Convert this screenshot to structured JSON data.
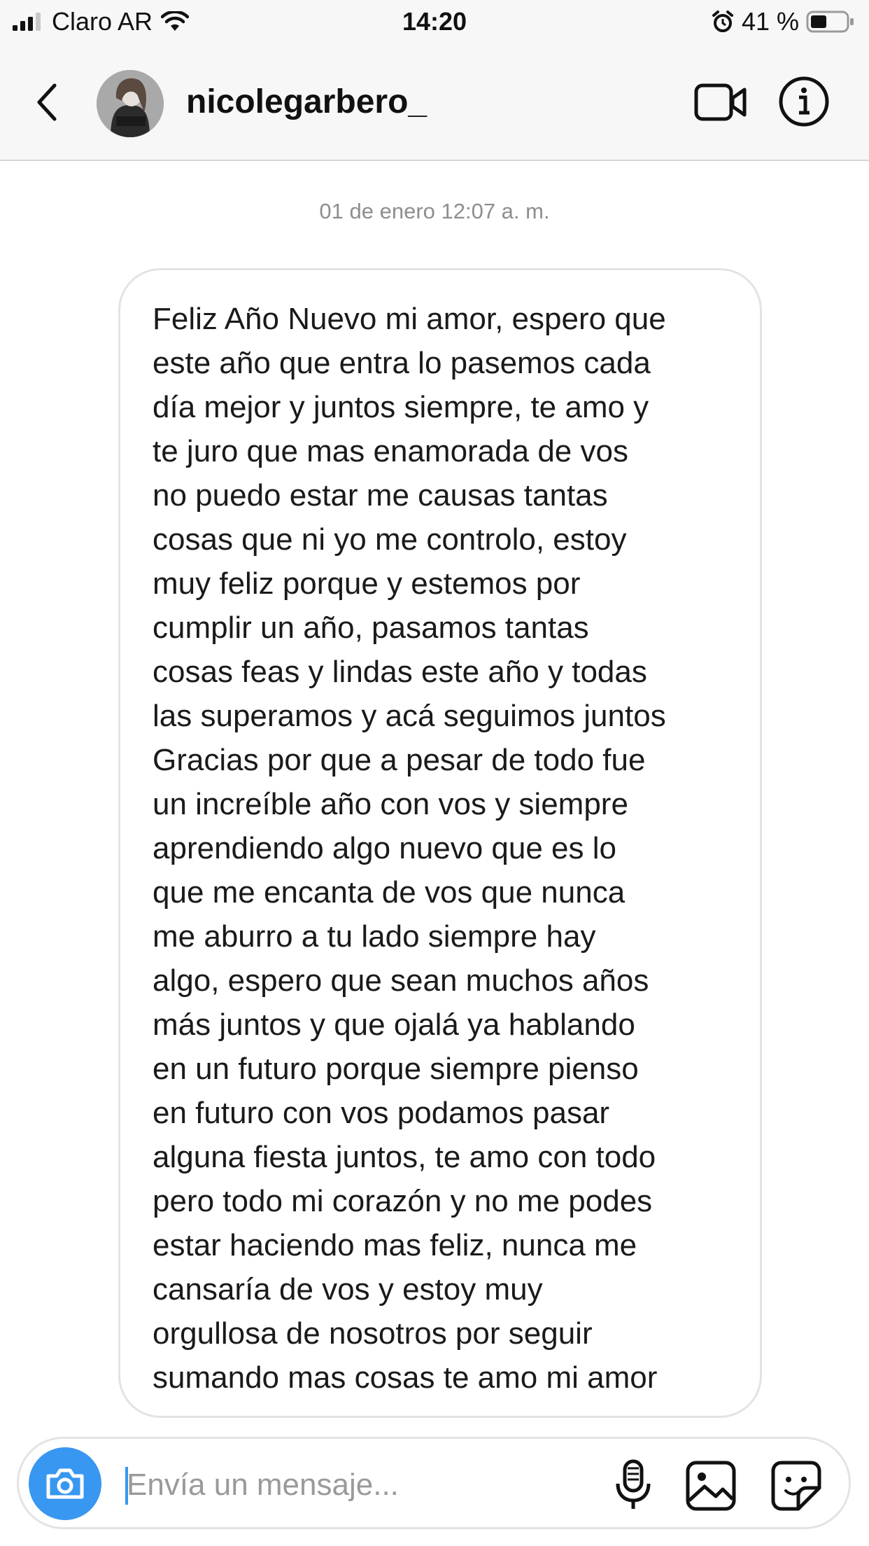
{
  "status_bar": {
    "carrier": "Claro AR",
    "time": "14:20",
    "battery": "41 %",
    "icons": [
      "signal-icon",
      "wifi-icon",
      "alarm-icon",
      "battery-icon"
    ]
  },
  "header": {
    "username": "nicolegarbero_",
    "icons": [
      "back-arrow-icon",
      "video-call-icon",
      "info-icon"
    ]
  },
  "conversation": {
    "timestamp": "01 de enero 12:07 a. m.",
    "message": "Feliz Año Nuevo mi amor, espero que\neste año que entra lo pasemos cada\ndía mejor y juntos siempre, te amo y\nte juro que mas enamorada de vos\nno puedo estar me causas tantas\ncosas que ni yo me controlo, estoy\nmuy feliz porque y estemos por\ncumplir un año, pasamos tantas\ncosas feas y lindas este año y todas\nlas superamos y acá seguimos juntos\nGracias por que a pesar de todo fue\nun increíble año con vos y siempre\naprendiendo algo nuevo que es lo\nque me encanta de vos que nunca\nme aburro a tu lado siempre hay\nalgo, espero que sean muchos años\nmás juntos y que ojalá ya hablando\nen un futuro porque siempre pienso\nen futuro con vos podamos pasar\nalguna fiesta juntos, te amo con todo\npero todo mi corazón y no me podes\nestar haciendo mas feliz, nunca me\ncansaría de vos y estoy muy\norgullosa de nosotros por seguir\nsumando mas cosas te amo mi amor"
  },
  "composer": {
    "placeholder": "Envía un mensaje...",
    "value": "",
    "icons": [
      "camera-icon",
      "microphone-icon",
      "gallery-icon",
      "sticker-icon"
    ]
  },
  "colors": {
    "accent": "#3897f0",
    "timestamp_gray": "#8e8e8e",
    "border_gray": "#e3e3e3",
    "bar_background": "#f7f7f7"
  }
}
